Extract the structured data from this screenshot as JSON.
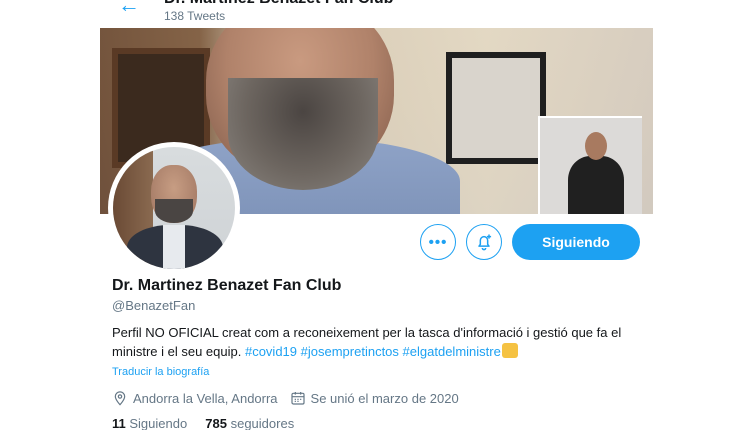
{
  "header": {
    "title": "Dr. Martinez Benazet Fan Club",
    "tweet_count": "138 Tweets"
  },
  "profile": {
    "name": "Dr. Martinez Benazet Fan Club",
    "handle": "@BenazetFan",
    "bio_text": "Perfil NO OFICIAL creat com a reconeixement per la tasca d'informació i gestió que fa el ministre i el seu equip.",
    "hashtags": [
      "#covid19",
      "#josempretinctos",
      "#elgatdelministre"
    ],
    "translate_link": "Traducir la biografía",
    "location": "Andorra la Vella, Andorra",
    "joined": "Se unió el marzo de 2020",
    "following_count": "11",
    "following_label": "Siguiendo",
    "followers_count": "785",
    "followers_label": "seguidores"
  },
  "actions": {
    "more_label": "•••",
    "follow_label": "Siguiendo"
  },
  "colors": {
    "accent": "#1da1f2",
    "secondary_text": "#657786"
  },
  "icons": [
    "back-arrow-icon",
    "more-icon",
    "bell-plus-icon",
    "location-pin-icon",
    "calendar-icon",
    "emoji-icon"
  ]
}
